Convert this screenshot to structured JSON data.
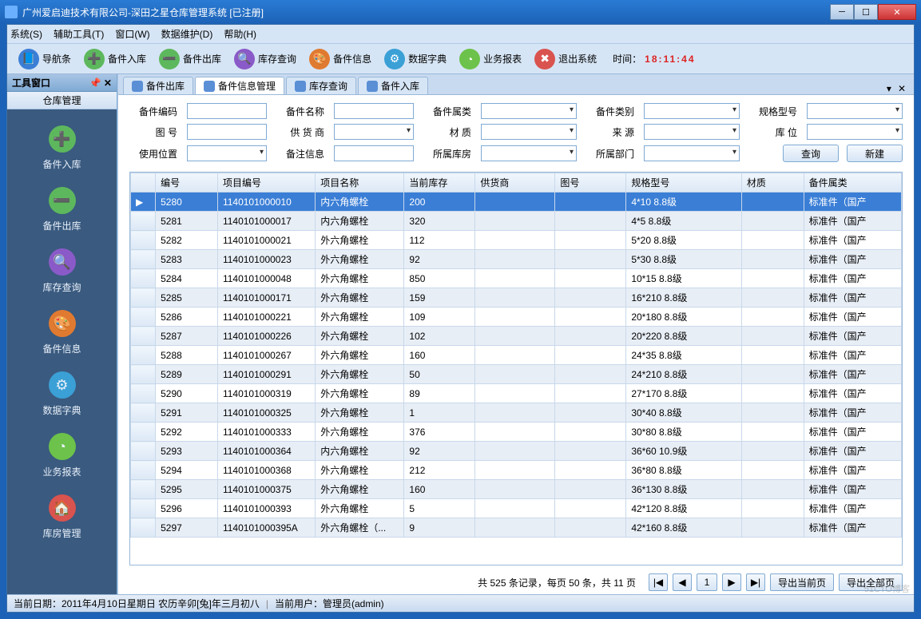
{
  "window": {
    "title": "广州爱启迪技术有限公司-深田之星仓库管理系统 [已注册]"
  },
  "menu": {
    "m0": "系统(S)",
    "m1": "辅助工具(T)",
    "m2": "窗口(W)",
    "m3": "数据维护(D)",
    "m4": "帮助(H)"
  },
  "toolbar": {
    "t0": "导航条",
    "t1": "备件入库",
    "t2": "备件出库",
    "t3": "库存查询",
    "t4": "备件信息",
    "t5": "数据字典",
    "t6": "业务报表",
    "t7": "退出系统",
    "timeLabel": "时间：",
    "time": "18:11:44"
  },
  "sidebar": {
    "panelTitle": "工具窗口",
    "sectionTitle": "仓库管理",
    "items": [
      {
        "label": "备件入库"
      },
      {
        "label": "备件出库"
      },
      {
        "label": "库存查询"
      },
      {
        "label": "备件信息"
      },
      {
        "label": "数据字典"
      },
      {
        "label": "业务报表"
      },
      {
        "label": "库房管理"
      }
    ]
  },
  "tabs": {
    "t0": "备件出库",
    "t1": "备件信息管理",
    "t2": "库存查询",
    "t3": "备件入库"
  },
  "filter": {
    "bjbm": "备件编码",
    "bjmc": "备件名称",
    "bjsl": "备件属类",
    "bjlb": "备件类别",
    "ggxh": "规格型号",
    "th": "图  号",
    "ghs": "供 货 商",
    "cz": "材  质",
    "ly": "来  源",
    "kw": "库  位",
    "sywz": "使用位置",
    "bzxx": "备注信息",
    "sskf": "所属库房",
    "ssbm": "所属部门",
    "query": "查询",
    "create": "新建"
  },
  "grid": {
    "headers": {
      "c0": "编号",
      "c1": "项目编号",
      "c2": "项目名称",
      "c3": "当前库存",
      "c4": "供货商",
      "c5": "图号",
      "c6": "规格型号",
      "c7": "材质",
      "c8": "备件属类"
    },
    "rows": [
      {
        "c0": "5280",
        "c1": "1140101000010",
        "c2": "内六角螺栓",
        "c3": "200",
        "c6": "4*10    8.8级",
        "c8": "标准件（国产"
      },
      {
        "c0": "5281",
        "c1": "1140101000017",
        "c2": "内六角螺栓",
        "c3": "320",
        "c6": "4*5    8.8级",
        "c8": "标准件（国产"
      },
      {
        "c0": "5282",
        "c1": "1140101000021",
        "c2": "外六角螺栓",
        "c3": "112",
        "c6": "5*20    8.8级",
        "c8": "标准件（国产"
      },
      {
        "c0": "5283",
        "c1": "1140101000023",
        "c2": "外六角螺栓",
        "c3": "92",
        "c6": "5*30    8.8级",
        "c8": "标准件（国产"
      },
      {
        "c0": "5284",
        "c1": "1140101000048",
        "c2": "外六角螺栓",
        "c3": "850",
        "c6": "10*15   8.8级",
        "c8": "标准件（国产"
      },
      {
        "c0": "5285",
        "c1": "1140101000171",
        "c2": "外六角螺栓",
        "c3": "159",
        "c6": "16*210   8.8级",
        "c8": "标准件（国产"
      },
      {
        "c0": "5286",
        "c1": "1140101000221",
        "c2": "外六角螺栓",
        "c3": "109",
        "c6": "20*180   8.8级",
        "c8": "标准件（国产"
      },
      {
        "c0": "5287",
        "c1": "1140101000226",
        "c2": "外六角螺栓",
        "c3": "102",
        "c6": "20*220   8.8级",
        "c8": "标准件（国产"
      },
      {
        "c0": "5288",
        "c1": "1140101000267",
        "c2": "外六角螺栓",
        "c3": "160",
        "c6": "24*35   8.8级",
        "c8": "标准件（国产"
      },
      {
        "c0": "5289",
        "c1": "1140101000291",
        "c2": "外六角螺栓",
        "c3": "50",
        "c6": "24*210   8.8级",
        "c8": "标准件（国产"
      },
      {
        "c0": "5290",
        "c1": "1140101000319",
        "c2": "外六角螺栓",
        "c3": "89",
        "c6": "27*170   8.8级",
        "c8": "标准件（国产"
      },
      {
        "c0": "5291",
        "c1": "1140101000325",
        "c2": "外六角螺栓",
        "c3": "1",
        "c6": "30*40   8.8级",
        "c8": "标准件（国产"
      },
      {
        "c0": "5292",
        "c1": "1140101000333",
        "c2": "外六角螺栓",
        "c3": "376",
        "c6": "30*80   8.8级",
        "c8": "标准件（国产"
      },
      {
        "c0": "5293",
        "c1": "1140101000364",
        "c2": "内六角螺栓",
        "c3": "92",
        "c6": "36*60   10.9级",
        "c8": "标准件（国产"
      },
      {
        "c0": "5294",
        "c1": "1140101000368",
        "c2": "外六角螺栓",
        "c3": "212",
        "c6": "36*80   8.8级",
        "c8": "标准件（国产"
      },
      {
        "c0": "5295",
        "c1": "1140101000375",
        "c2": "外六角螺栓",
        "c3": "160",
        "c6": "36*130  8.8级",
        "c8": "标准件（国产"
      },
      {
        "c0": "5296",
        "c1": "1140101000393",
        "c2": "外六角螺栓",
        "c3": "5",
        "c6": "42*120   8.8级",
        "c8": "标准件（国产"
      },
      {
        "c0": "5297",
        "c1": "1140101000395A",
        "c2": "外六角螺栓（...",
        "c3": "9",
        "c6": "42*160  8.8级",
        "c8": "标准件（国产"
      }
    ]
  },
  "pager": {
    "info": "共 525 条记录，每页 50 条，共 11 页",
    "first": "|◀",
    "prev": "◀",
    "page": "1",
    "next": "▶",
    "last": "▶|",
    "exportCur": "导出当前页",
    "exportAll": "导出全部页"
  },
  "status": {
    "date": "当前日期：2011年4月10日星期日 农历辛卯[兔]年三月初八",
    "user": "当前用户：管理员(admin)"
  },
  "watermark": "51CTO博客"
}
